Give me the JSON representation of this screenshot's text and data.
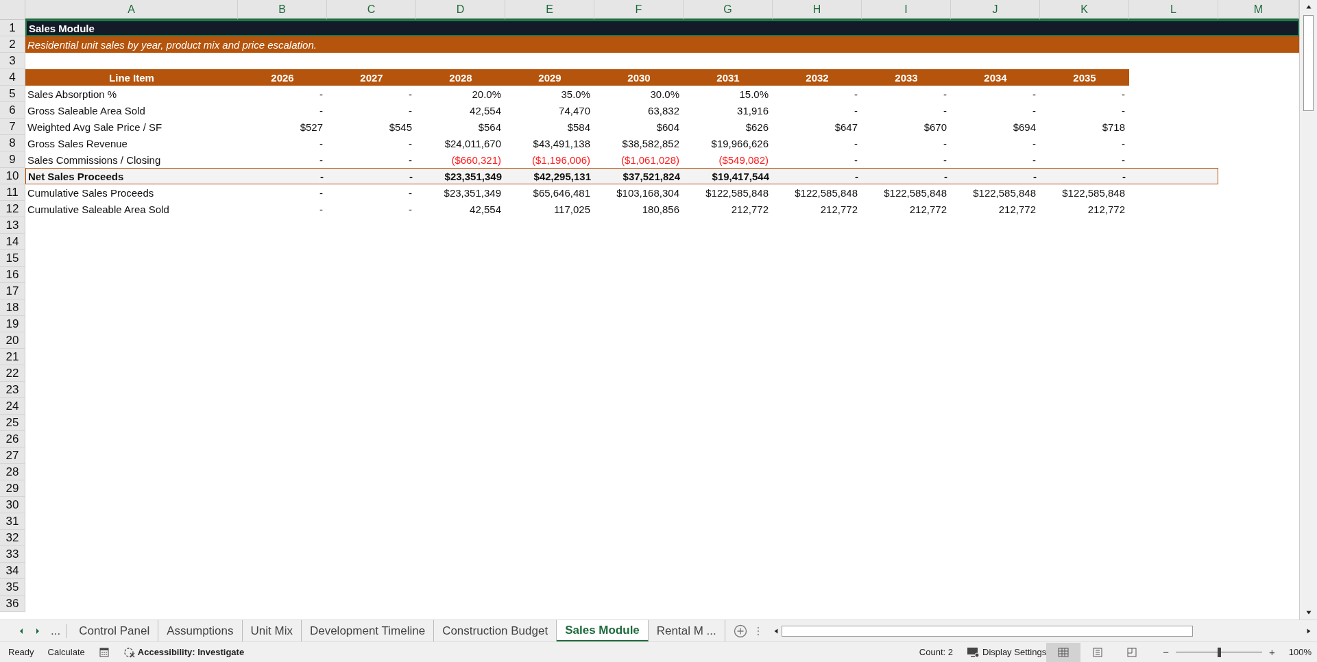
{
  "columns": [
    "A",
    "B",
    "C",
    "D",
    "E",
    "F",
    "G",
    "H",
    "I",
    "J",
    "K",
    "L",
    "M"
  ],
  "rows": [
    {
      "number": "1",
      "kind": "title",
      "text": "Sales Module"
    },
    {
      "number": "2",
      "kind": "subtitle",
      "text": "Residential unit sales by year, product mix and price escalation."
    },
    {
      "number": "3",
      "kind": "blank"
    },
    {
      "number": "4",
      "kind": "header",
      "label": "Line Item",
      "values": [
        "2026",
        "2027",
        "2028",
        "2029",
        "2030",
        "2031",
        "2032",
        "2033",
        "2034",
        "2035"
      ]
    },
    {
      "number": "5",
      "kind": "data",
      "label": "Sales Absorption %",
      "values": [
        "-",
        "-",
        "20.0%",
        "35.0%",
        "30.0%",
        "15.0%",
        "-",
        "-",
        "-",
        "-"
      ]
    },
    {
      "number": "6",
      "kind": "data",
      "label": "Gross Saleable Area Sold",
      "values": [
        "-",
        "-",
        "42,554",
        "74,470",
        "63,832",
        "31,916",
        "-",
        "-",
        "-",
        "-"
      ]
    },
    {
      "number": "7",
      "kind": "data",
      "label": "Weighted Avg Sale Price / SF",
      "values": [
        "$527",
        "$545",
        "$564",
        "$584",
        "$604",
        "$626",
        "$647",
        "$670",
        "$694",
        "$718"
      ]
    },
    {
      "number": "8",
      "kind": "data",
      "label": "Gross Sales Revenue",
      "values": [
        "-",
        "-",
        "$24,011,670",
        "$43,491,138",
        "$38,582,852",
        "$19,966,626",
        "-",
        "-",
        "-",
        "-"
      ]
    },
    {
      "number": "9",
      "kind": "data",
      "label": "Sales Commissions / Closing",
      "values": [
        "-",
        "-",
        "($660,321)",
        "($1,196,006)",
        "($1,061,028)",
        "($549,082)",
        "-",
        "-",
        "-",
        "-"
      ],
      "red": [
        false,
        false,
        true,
        true,
        true,
        true,
        false,
        false,
        false,
        false
      ]
    },
    {
      "number": "10",
      "kind": "total",
      "label": "Net Sales Proceeds",
      "values": [
        "-",
        "-",
        "$23,351,349",
        "$42,295,131",
        "$37,521,824",
        "$19,417,544",
        "-",
        "-",
        "-",
        "-"
      ]
    },
    {
      "number": "11",
      "kind": "data",
      "label": "Cumulative Sales Proceeds",
      "values": [
        "-",
        "-",
        "$23,351,349",
        "$65,646,481",
        "$103,168,304",
        "$122,585,848",
        "$122,585,848",
        "$122,585,848",
        "$122,585,848",
        "$122,585,848"
      ]
    },
    {
      "number": "12",
      "kind": "data",
      "label": "Cumulative Saleable Area Sold",
      "values": [
        "-",
        "-",
        "42,554",
        "117,025",
        "180,856",
        "212,772",
        "212,772",
        "212,772",
        "212,772",
        "212,772"
      ]
    },
    {
      "number": "13",
      "kind": "blank"
    },
    {
      "number": "14",
      "kind": "blank"
    },
    {
      "number": "15",
      "kind": "blank"
    },
    {
      "number": "16",
      "kind": "blank"
    },
    {
      "number": "17",
      "kind": "blank"
    },
    {
      "number": "18",
      "kind": "blank"
    },
    {
      "number": "19",
      "kind": "blank"
    },
    {
      "number": "20",
      "kind": "blank"
    },
    {
      "number": "21",
      "kind": "blank"
    },
    {
      "number": "22",
      "kind": "blank"
    },
    {
      "number": "23",
      "kind": "blank"
    },
    {
      "number": "24",
      "kind": "blank"
    },
    {
      "number": "25",
      "kind": "blank"
    },
    {
      "number": "26",
      "kind": "blank"
    },
    {
      "number": "27",
      "kind": "blank"
    },
    {
      "number": "28",
      "kind": "blank"
    },
    {
      "number": "29",
      "kind": "blank"
    },
    {
      "number": "30",
      "kind": "blank"
    },
    {
      "number": "31",
      "kind": "blank"
    },
    {
      "number": "32",
      "kind": "blank"
    },
    {
      "number": "33",
      "kind": "blank"
    },
    {
      "number": "34",
      "kind": "blank"
    },
    {
      "number": "35",
      "kind": "blank"
    },
    {
      "number": "36",
      "kind": "blank"
    }
  ],
  "sheet_tabs": {
    "more": "...",
    "tabs": [
      {
        "label": "Control Panel",
        "selected": false
      },
      {
        "label": "Assumptions",
        "selected": false
      },
      {
        "label": "Unit Mix",
        "selected": false
      },
      {
        "label": "Development Timeline",
        "selected": false
      },
      {
        "label": "Construction Budget",
        "selected": false
      },
      {
        "label": "Sales Module",
        "selected": true
      },
      {
        "label": "Rental M ...",
        "selected": false
      }
    ]
  },
  "status_bar": {
    "mode": "Ready",
    "calculate": "Calculate",
    "accessibility": "Accessibility: Investigate",
    "count": "Count: 2",
    "display_settings": "Display Settings",
    "views": [
      {
        "kind": "normal",
        "selected": true
      },
      {
        "kind": "page-layout",
        "selected": false
      },
      {
        "kind": "page-break",
        "selected": false
      }
    ],
    "zoom": {
      "minus": "−",
      "plus": "+",
      "level": 0.5,
      "reading": "100%"
    }
  }
}
